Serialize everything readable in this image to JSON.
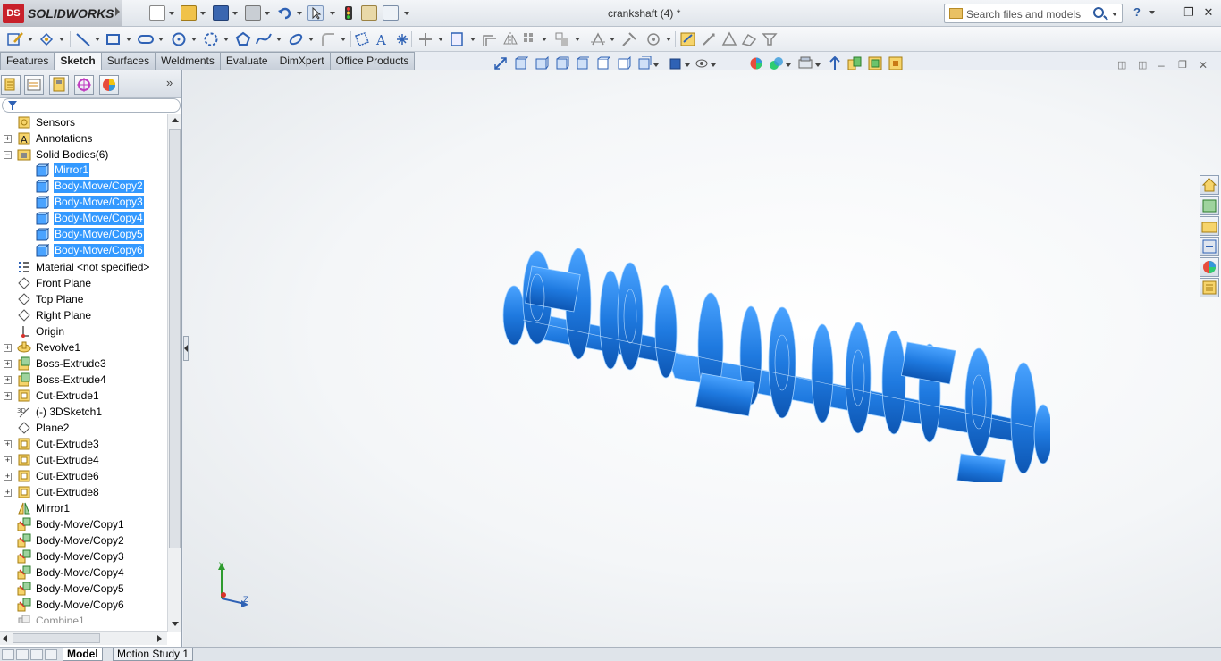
{
  "app": {
    "logo_ds": "DS",
    "logo_name": "SOLIDWORKS",
    "document_title": "crankshaft (4) *"
  },
  "search": {
    "placeholder": "Search files and models"
  },
  "tabs": [
    "Features",
    "Sketch",
    "Surfaces",
    "Weldments",
    "Evaluate",
    "DimXpert",
    "Office Products"
  ],
  "active_tab": "Sketch",
  "tree": [
    {
      "label": "Sensors",
      "expander": "",
      "indent": 0,
      "icon": "sensors-icon",
      "state": "normal"
    },
    {
      "label": "Annotations",
      "expander": "+",
      "indent": 0,
      "icon": "annotations-icon",
      "state": "normal"
    },
    {
      "label": "Solid Bodies(6)",
      "expander": "-",
      "indent": 0,
      "icon": "solid-bodies-folder-icon",
      "state": "normal"
    },
    {
      "label": "Mirror1",
      "expander": "",
      "indent": 1,
      "icon": "solid-body-icon",
      "state": "selected"
    },
    {
      "label": "Body-Move/Copy2",
      "expander": "",
      "indent": 1,
      "icon": "solid-body-icon",
      "state": "selected"
    },
    {
      "label": "Body-Move/Copy3",
      "expander": "",
      "indent": 1,
      "icon": "solid-body-icon",
      "state": "selected"
    },
    {
      "label": "Body-Move/Copy4",
      "expander": "",
      "indent": 1,
      "icon": "solid-body-icon",
      "state": "selected"
    },
    {
      "label": "Body-Move/Copy5",
      "expander": "",
      "indent": 1,
      "icon": "solid-body-icon",
      "state": "selected"
    },
    {
      "label": "Body-Move/Copy6",
      "expander": "",
      "indent": 1,
      "icon": "solid-body-icon",
      "state": "selected"
    },
    {
      "label": "Material <not specified>",
      "expander": "",
      "indent": 0,
      "icon": "material-icon",
      "state": "normal"
    },
    {
      "label": "Front Plane",
      "expander": "",
      "indent": 0,
      "icon": "plane-icon",
      "state": "normal"
    },
    {
      "label": "Top Plane",
      "expander": "",
      "indent": 0,
      "icon": "plane-icon",
      "state": "normal"
    },
    {
      "label": "Right Plane",
      "expander": "",
      "indent": 0,
      "icon": "plane-icon",
      "state": "normal"
    },
    {
      "label": "Origin",
      "expander": "",
      "indent": 0,
      "icon": "origin-icon",
      "state": "normal"
    },
    {
      "label": "Revolve1",
      "expander": "+",
      "indent": 0,
      "icon": "revolve-icon",
      "state": "normal"
    },
    {
      "label": "Boss-Extrude3",
      "expander": "+",
      "indent": 0,
      "icon": "extrude-icon",
      "state": "normal"
    },
    {
      "label": "Boss-Extrude4",
      "expander": "+",
      "indent": 0,
      "icon": "extrude-icon",
      "state": "normal"
    },
    {
      "label": "Cut-Extrude1",
      "expander": "+",
      "indent": 0,
      "icon": "cut-extrude-icon",
      "state": "normal"
    },
    {
      "label": "(-) 3DSketch1",
      "expander": "",
      "indent": 0,
      "icon": "3d-sketch-icon",
      "state": "normal"
    },
    {
      "label": "Plane2",
      "expander": "",
      "indent": 0,
      "icon": "plane-icon",
      "state": "normal"
    },
    {
      "label": "Cut-Extrude3",
      "expander": "+",
      "indent": 0,
      "icon": "cut-extrude-icon",
      "state": "normal"
    },
    {
      "label": "Cut-Extrude4",
      "expander": "+",
      "indent": 0,
      "icon": "cut-extrude-icon",
      "state": "normal"
    },
    {
      "label": "Cut-Extrude6",
      "expander": "+",
      "indent": 0,
      "icon": "cut-extrude-icon",
      "state": "normal"
    },
    {
      "label": "Cut-Extrude8",
      "expander": "+",
      "indent": 0,
      "icon": "cut-extrude-icon",
      "state": "normal"
    },
    {
      "label": "Mirror1",
      "expander": "",
      "indent": 0,
      "icon": "mirror-icon",
      "state": "normal"
    },
    {
      "label": "Body-Move/Copy1",
      "expander": "",
      "indent": 0,
      "icon": "move-copy-icon",
      "state": "normal"
    },
    {
      "label": "Body-Move/Copy2",
      "expander": "",
      "indent": 0,
      "icon": "move-copy-icon",
      "state": "normal"
    },
    {
      "label": "Body-Move/Copy3",
      "expander": "",
      "indent": 0,
      "icon": "move-copy-icon",
      "state": "normal"
    },
    {
      "label": "Body-Move/Copy4",
      "expander": "",
      "indent": 0,
      "icon": "move-copy-icon",
      "state": "normal"
    },
    {
      "label": "Body-Move/Copy5",
      "expander": "",
      "indent": 0,
      "icon": "move-copy-icon",
      "state": "normal"
    },
    {
      "label": "Body-Move/Copy6",
      "expander": "",
      "indent": 0,
      "icon": "move-copy-icon",
      "state": "normal"
    },
    {
      "label": "Combine1",
      "expander": "",
      "indent": 0,
      "icon": "combine-icon",
      "state": "dimmed"
    }
  ],
  "bottom_tabs": [
    "Model",
    "Motion Study 1"
  ],
  "active_bottom_tab": "Model",
  "triad": {
    "y": "Y",
    "z": "Z"
  },
  "colors": {
    "model_blue": "#1f7ae0",
    "selection": "#3399ff",
    "logo_red": "#c8202a"
  }
}
